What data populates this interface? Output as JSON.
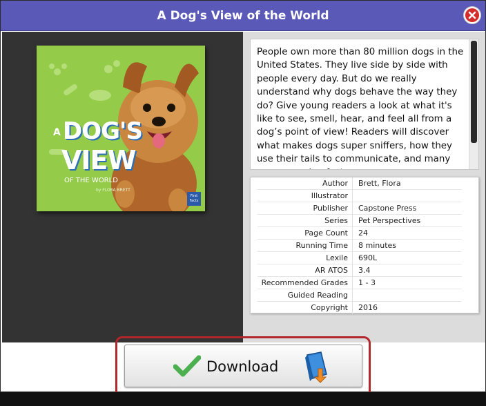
{
  "dialog": {
    "title": "A Dog's View of the World"
  },
  "cover": {
    "title_line1": "A",
    "title_line2": "DOG'S",
    "title_line3": "VIEW",
    "title_line4": "OF THE WORLD",
    "author_credit": "by FLORA BRETT",
    "publisher_badge": "First Facts",
    "bg_color": "#8cc63f"
  },
  "description": {
    "text": "People own more than 80 million dogs in the United States. They live side by side with people every day. But do we really understand why dogs behave the way they do? Give young readers a look at what it's like to see, smell, hear, and feel all from a dog’s point of view! Readers will discover what makes dogs super sniffers, how they use their tails to communicate, and many more amazing facts."
  },
  "details": [
    {
      "label": "Author",
      "value": "Brett, Flora"
    },
    {
      "label": "Illustrator",
      "value": ""
    },
    {
      "label": "Publisher",
      "value": "Capstone Press"
    },
    {
      "label": "Series",
      "value": "Pet Perspectives"
    },
    {
      "label": "Page Count",
      "value": "24"
    },
    {
      "label": "Running Time",
      "value": "8 minutes"
    },
    {
      "label": "Lexile",
      "value": "690L"
    },
    {
      "label": "AR ATOS",
      "value": "3.4"
    },
    {
      "label": "Recommended Grades",
      "value": "1 - 3"
    },
    {
      "label": "Guided Reading",
      "value": ""
    },
    {
      "label": "Copyright",
      "value": "2016"
    }
  ],
  "download": {
    "label": "Download",
    "icon_left": "checkmark-icon",
    "icon_right": "book-download-icon"
  },
  "colors": {
    "titlebar": "#5b59b7",
    "close": "#d62b2b",
    "highlight": "#b3262b",
    "check": "#4caf50"
  }
}
